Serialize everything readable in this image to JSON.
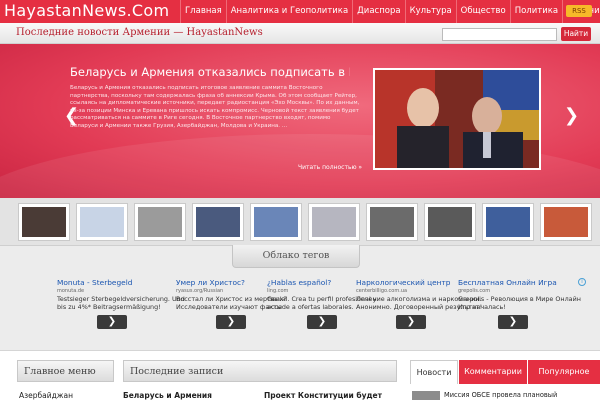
{
  "header": {
    "logo": "HayastanNews.Com",
    "nav": [
      "Главная",
      "Аналитика и Геополитика",
      "Диаспора",
      "Культура",
      "Общество",
      "Политика",
      "Страницы"
    ],
    "rss": "RSS",
    "tagline": "Последние новости Армении — HayastanNews",
    "search_placeholder": "",
    "search_button": "Найти"
  },
  "slider": {
    "title": "Беларусь и Армения отказались подписать в Р...",
    "body": "Беларусь и Армения отказались подписать итоговое заявление саммита Восточного партнерства, поскольку там содержалась фраза об аннексии Крыма. Об этом сообщает Рейтер, ссылаясь на дипломатические источники, передает радиостанция «Эхо Москвы». По их данным, из-за позиции Минска и Еревана пришлось искать компромисс. Черновой текст заявления будет рассматриваться на саммите в Риге сегодня. В Восточное партнерство входят, помимо Беларуси и Армении также Грузия, Азербайджан, Молдова и Украина. ...",
    "read_more": "Читать полностью »",
    "prev": "❮",
    "next": "❯"
  },
  "thumbnails": [
    {
      "color": "#4a3b36"
    },
    {
      "color": "#c8d4e6"
    },
    {
      "color": "#9b9b9b"
    },
    {
      "color": "#4a5a7e"
    },
    {
      "color": "#6a86b8"
    },
    {
      "color": "#b6b6c0"
    },
    {
      "color": "#6b6b6b"
    },
    {
      "color": "#5a5a5a"
    },
    {
      "color": "#3f5f9c"
    },
    {
      "color": "#c85a3a"
    },
    {
      "color": "#5f6872"
    }
  ],
  "tag_cloud": "Облако тегов",
  "ads": [
    {
      "title": "Monuta - Sterbegeld",
      "url": "monuta.de",
      "text": "Testsieger Sterbegeldversicherung. Und bis zu 4%* Beitragsermäßigung!",
      "btn": "❯"
    },
    {
      "title": "Умер ли Христос?",
      "url": "ryasus.org/Russian",
      "text": "Восстал ли Христос из мертвых? Исследователи изучают факты",
      "btn": "❯"
    },
    {
      "title": "¿Hablas español?",
      "url": "ling.com",
      "text": "Genial. Crea tu perfil profesional y accede a ofertas laborales.",
      "btn": "❯"
    },
    {
      "title": "Наркологический центр",
      "url": "centerbilligo.com.ua",
      "text": "Лечение алкоголизма и наркомании. Анонимно. Договоренный результат!",
      "btn": "❯"
    },
    {
      "title": "Бесплатная Онлайн Игра",
      "url": "grepolis.com",
      "text": "Grepolis - Революция в Мире Онлайн Игр началась!",
      "btn": "❯"
    }
  ],
  "ad_info": "i",
  "bottom": {
    "menu_head": "Главное меню",
    "recent_head": "Последние записи",
    "tabs": [
      "Новости",
      "Комментарии",
      "Популярное"
    ],
    "menu_item": "Азербайджан",
    "recent_1": "Беларусь и Армения",
    "recent_2": "Проект Конституции будет",
    "news_item": "Миссия ОБСЕ провела плановый"
  }
}
